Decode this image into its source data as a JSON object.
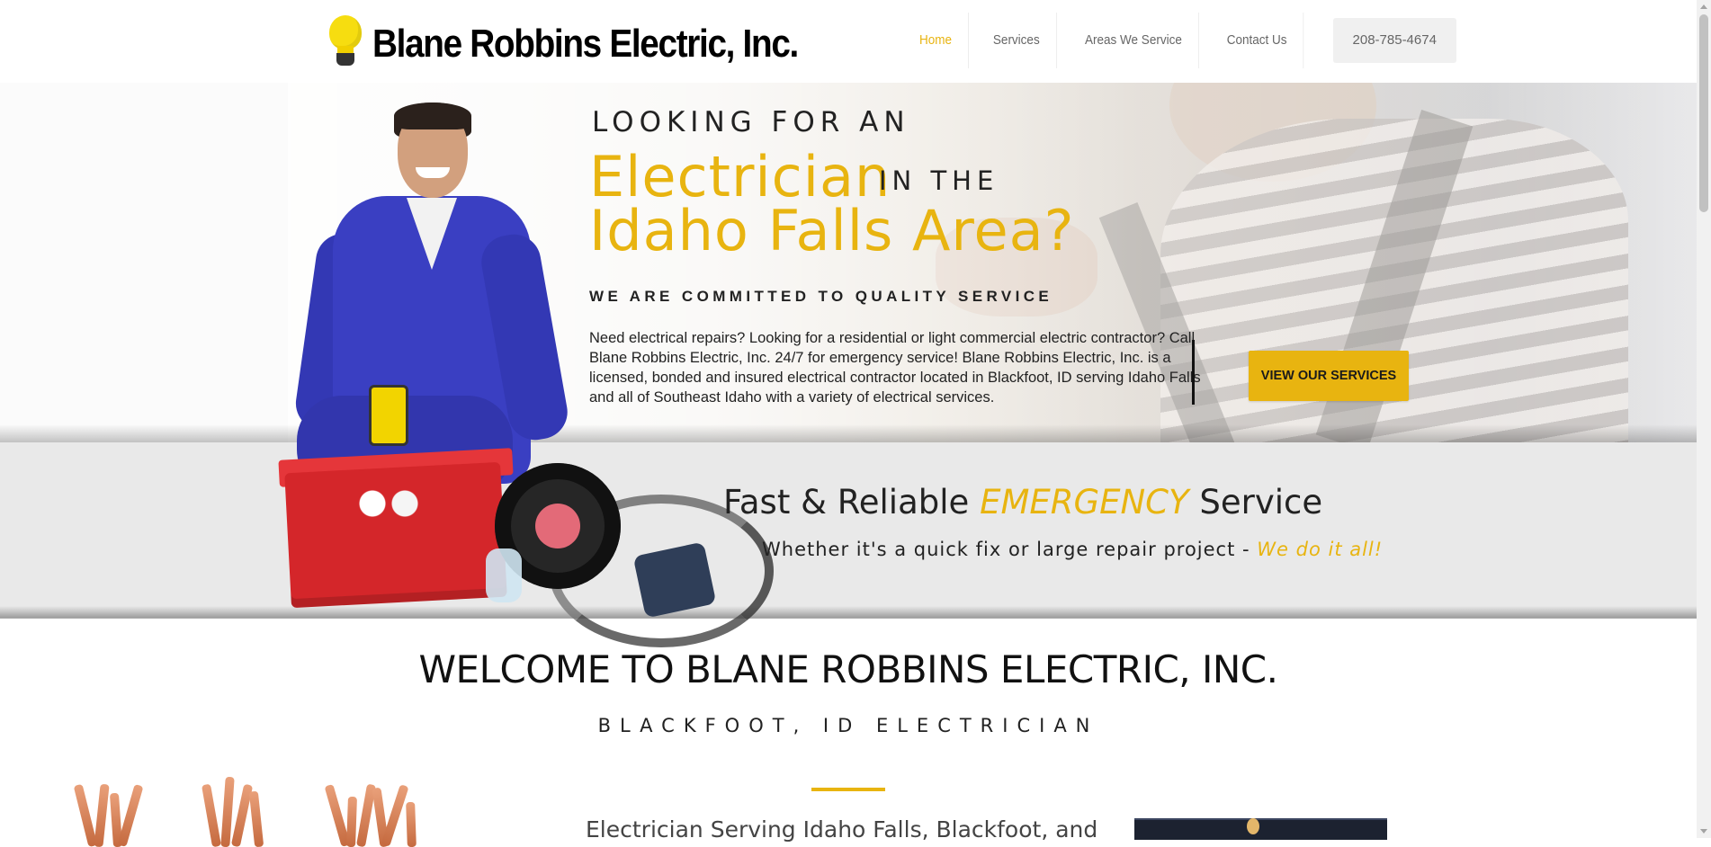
{
  "header": {
    "logo_text": "Blane Robbins Electric, Inc.",
    "nav": [
      {
        "label": "Home",
        "active": true
      },
      {
        "label": "Services",
        "active": false
      },
      {
        "label": "Areas We Service",
        "active": false
      },
      {
        "label": "Contact Us",
        "active": false
      }
    ],
    "phone": "208-785-4674"
  },
  "hero": {
    "kicker": "LOOKING FOR AN",
    "big_line1": "Electrician",
    "in_the": "IN THE",
    "big_line2": "Idaho Falls Area?",
    "commitment": "WE ARE COMMITTED TO QUALITY SERVICE",
    "paragraph": "Need electrical repairs? Looking for a residential or light commercial electric contractor? Call Blane Robbins Electric, Inc. 24/7 for emergency service! Blane Robbins Electric, Inc. is a licensed, bonded and insured electrical contractor located in Blackfoot, ID serving Idaho Falls and all of Southeast Idaho with a variety of electrical services.",
    "cta": "VIEW OUR SERVICES"
  },
  "emergency": {
    "title_pre": "Fast & Reliable",
    "title_em": "EMERGENCY",
    "title_post": "Service",
    "sub_pre": "Whether it's a quick fix or large repair project -",
    "sub_em": "We do it all!"
  },
  "welcome": {
    "title": "WELCOME TO BLANE ROBBINS ELECTRIC, INC.",
    "subtitle": "BLACKFOOT, ID ELECTRICIAN",
    "serving": "Electrician Serving Idaho Falls, Blackfoot, and"
  },
  "colors": {
    "accent": "#e8b410",
    "text": "#222222"
  }
}
